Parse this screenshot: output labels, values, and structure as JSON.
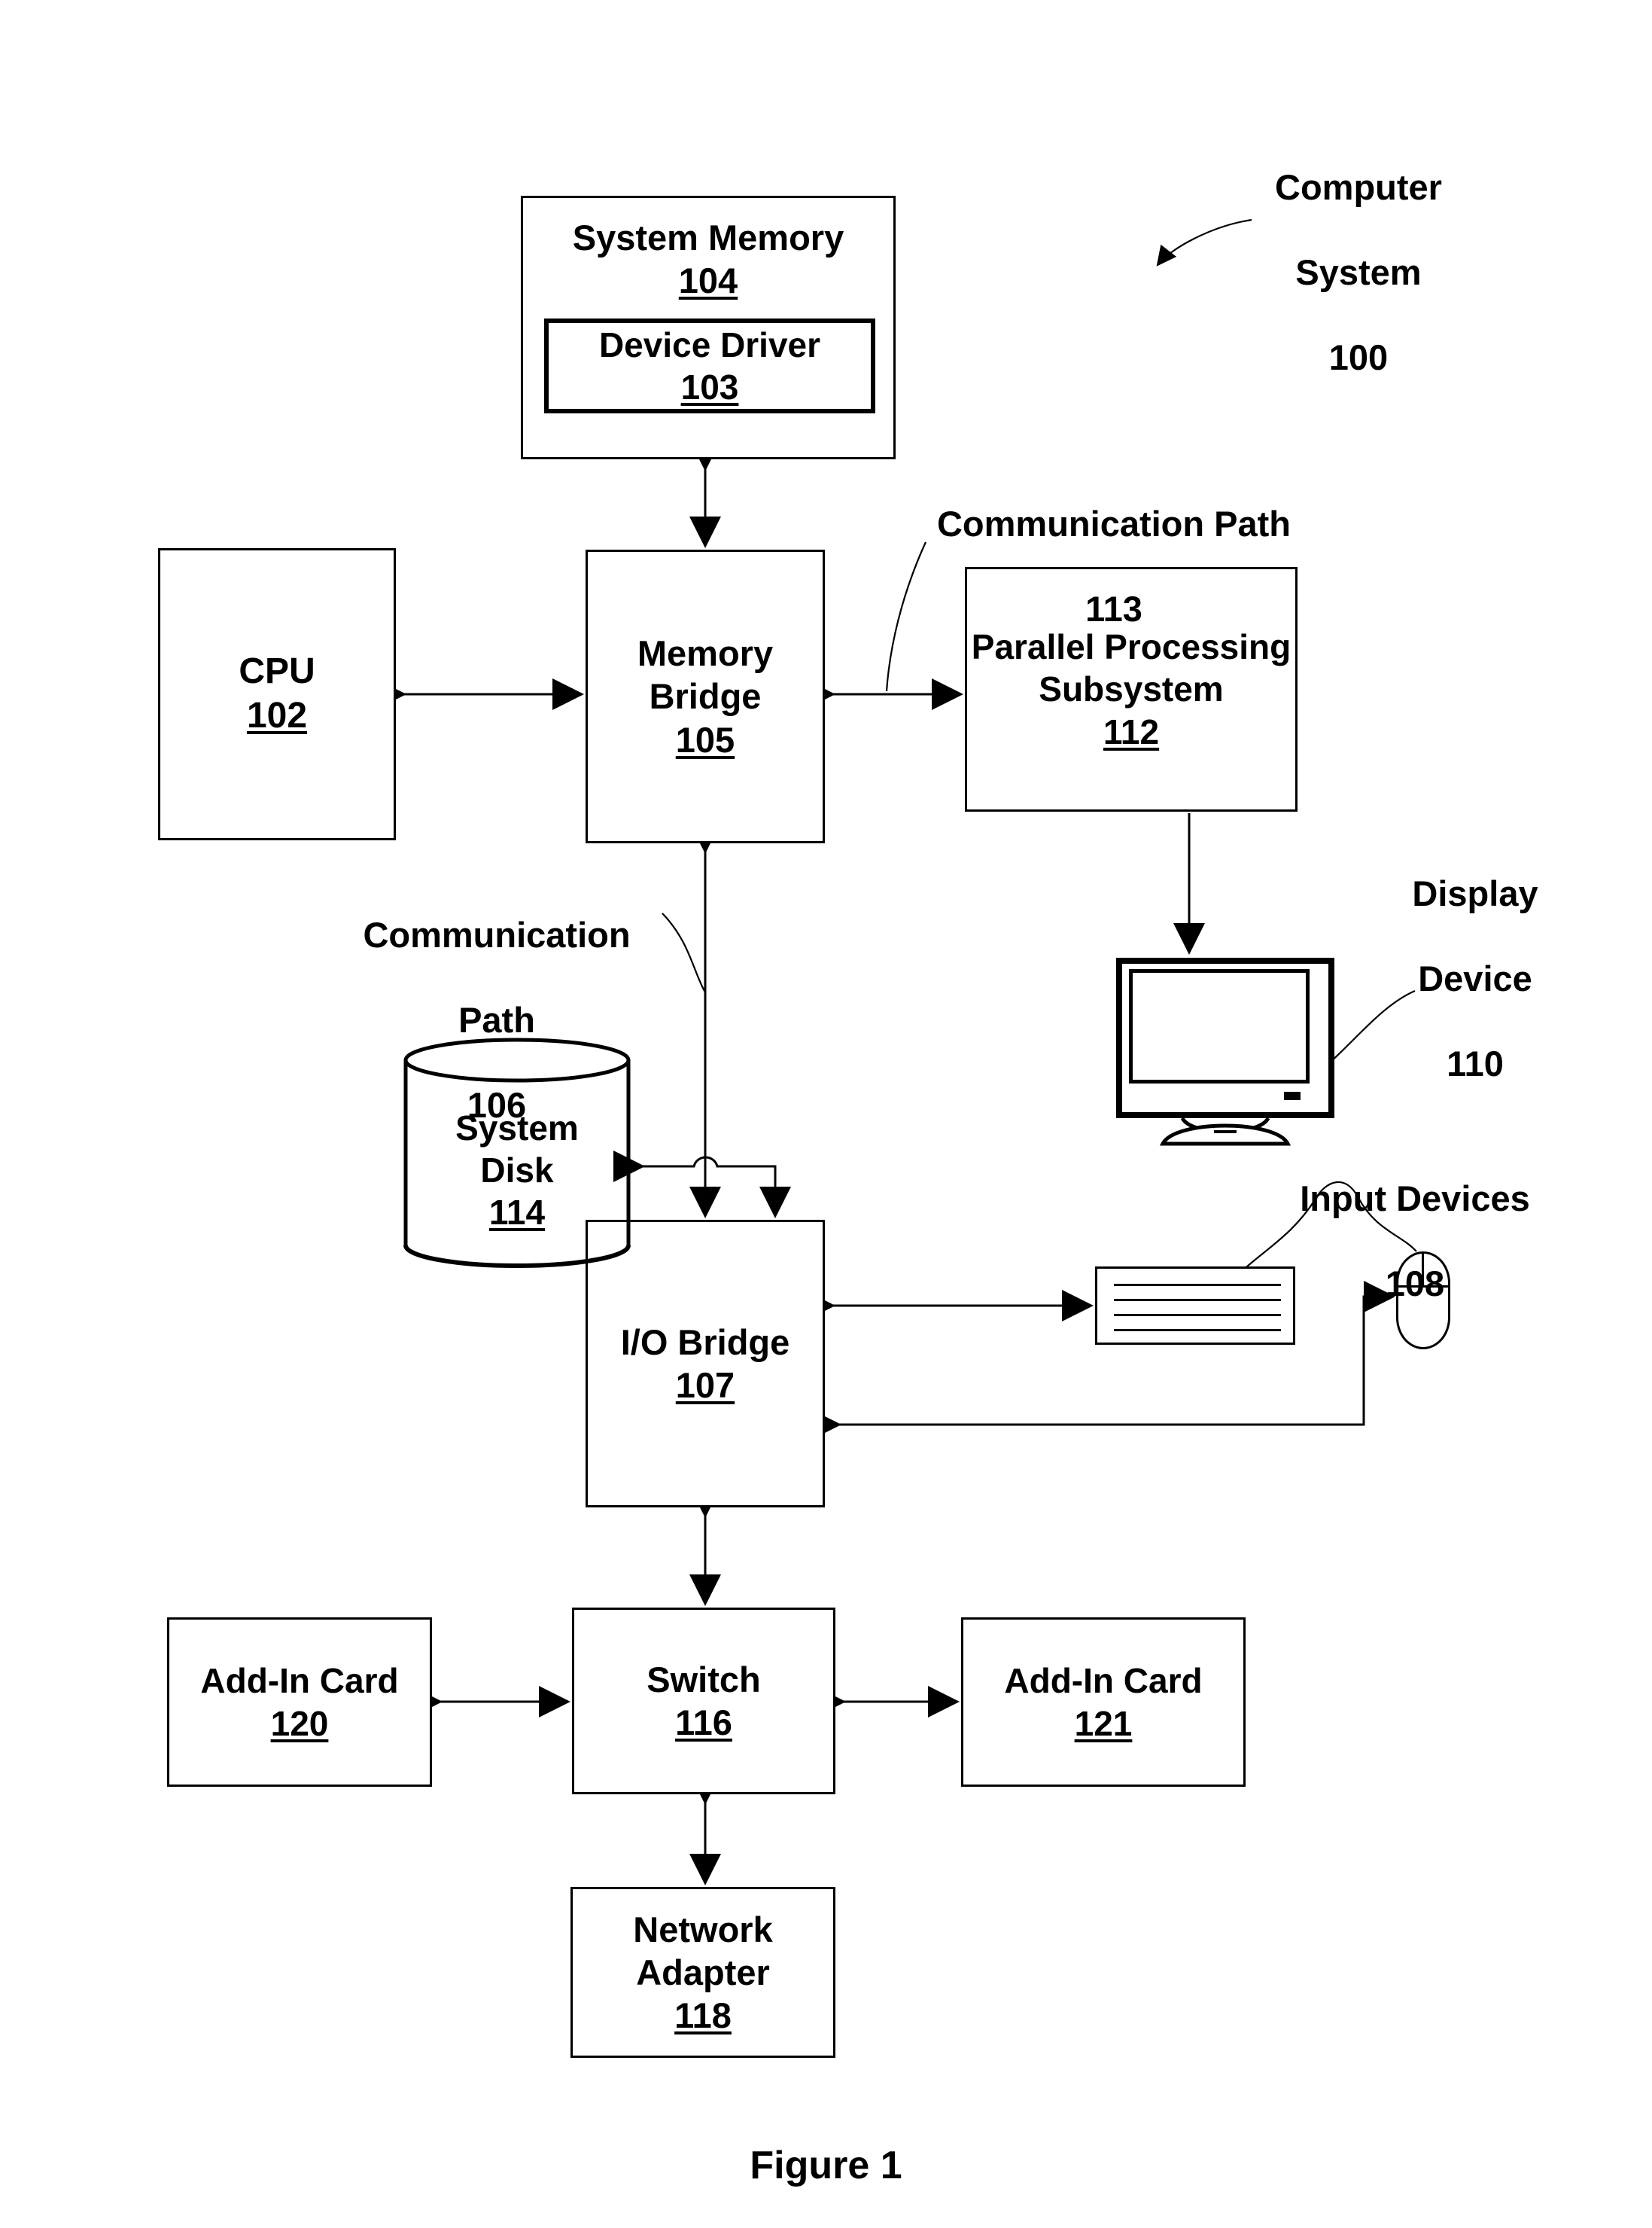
{
  "figure": {
    "caption": "Figure 1"
  },
  "nodes": {
    "system_memory": {
      "title": "System Memory",
      "ref": "104"
    },
    "device_driver": {
      "title": "Device Driver",
      "ref": "103"
    },
    "cpu": {
      "title": "CPU",
      "ref": "102"
    },
    "memory_bridge": {
      "title_line1": "Memory",
      "title_line2": "Bridge",
      "ref": "105"
    },
    "parallel_processing_subsystem": {
      "title_line1": "Parallel Processing",
      "title_line2": "Subsystem",
      "ref": "112"
    },
    "system_disk": {
      "title_line1": "System",
      "title_line2": "Disk",
      "ref": "114"
    },
    "io_bridge": {
      "title": "I/O Bridge",
      "ref": "107"
    },
    "switch": {
      "title": "Switch",
      "ref": "116"
    },
    "add_in_card_120": {
      "title": "Add-In Card",
      "ref": "120"
    },
    "add_in_card_121": {
      "title": "Add-In Card",
      "ref": "121"
    },
    "network_adapter": {
      "title_line1": "Network",
      "title_line2": "Adapter",
      "ref": "118"
    }
  },
  "labels": {
    "computer_system": {
      "line1": "Computer",
      "line2": "System",
      "ref": "100"
    },
    "communication_path_113": {
      "line1": "Communication Path",
      "ref": "113"
    },
    "communication_path_106": {
      "line1": "Communication",
      "line2": "Path",
      "ref": "106"
    },
    "display_device": {
      "line1": "Display",
      "line2": "Device",
      "ref": "110"
    },
    "input_devices": {
      "line1": "Input Devices",
      "ref": "108"
    }
  },
  "icons": {
    "display_device": "monitor-icon",
    "keyboard": "keyboard-icon",
    "mouse": "mouse-icon",
    "system_disk": "cylinder-database-icon"
  },
  "colors": {
    "stroke": "#000000",
    "background": "#ffffff"
  },
  "chart_data": {
    "type": "diagram",
    "title": "Figure 1",
    "blocks": [
      {
        "id": "104",
        "label": "System Memory"
      },
      {
        "id": "103",
        "label": "Device Driver"
      },
      {
        "id": "102",
        "label": "CPU"
      },
      {
        "id": "105",
        "label": "Memory Bridge"
      },
      {
        "id": "112",
        "label": "Parallel Processing Subsystem"
      },
      {
        "id": "110",
        "label": "Display Device"
      },
      {
        "id": "114",
        "label": "System Disk"
      },
      {
        "id": "107",
        "label": "I/O Bridge"
      },
      {
        "id": "108",
        "label": "Input Devices"
      },
      {
        "id": "116",
        "label": "Switch"
      },
      {
        "id": "120",
        "label": "Add-In Card"
      },
      {
        "id": "121",
        "label": "Add-In Card"
      },
      {
        "id": "118",
        "label": "Network Adapter"
      }
    ],
    "edges": [
      {
        "from": "104",
        "to": "105",
        "arrow": "both"
      },
      {
        "from": "102",
        "to": "105",
        "arrow": "both"
      },
      {
        "from": "105",
        "to": "112",
        "arrow": "both",
        "path_id": "113"
      },
      {
        "from": "112",
        "to": "110",
        "arrow": "to"
      },
      {
        "from": "105",
        "to": "107",
        "arrow": "both",
        "path_id": "106"
      },
      {
        "from": "107",
        "to": "114",
        "arrow": "both"
      },
      {
        "from": "107",
        "to": "108",
        "arrow": "both"
      },
      {
        "from": "107",
        "to": "116",
        "arrow": "both"
      },
      {
        "from": "116",
        "to": "120",
        "arrow": "both"
      },
      {
        "from": "116",
        "to": "121",
        "arrow": "both"
      },
      {
        "from": "116",
        "to": "118",
        "arrow": "both"
      }
    ]
  }
}
